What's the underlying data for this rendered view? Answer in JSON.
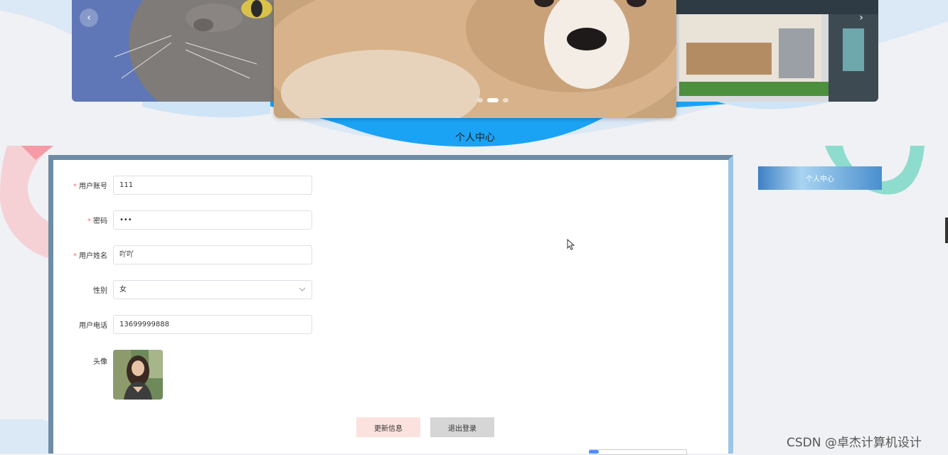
{
  "carousel": {
    "prev_icon": "chevron-left-icon",
    "next_icon": "chevron-right-icon",
    "prev_glyph": "‹",
    "next_glyph": "›",
    "slides": [
      "cat",
      "corgi",
      "pet-store"
    ],
    "active_index": 1
  },
  "page": {
    "title": "个人中心"
  },
  "form": {
    "username_label": "用户账号",
    "username_value": "111",
    "password_label": "密码",
    "password_value": "•••",
    "name_label": "用户姓名",
    "name_value": "吖吖",
    "gender_label": "性别",
    "gender_value": "女",
    "phone_label": "用户电话",
    "phone_value": "13699999888",
    "avatar_label": "头像",
    "required_mark": "*",
    "dropdown_icon": "chevron-down-icon"
  },
  "actions": {
    "update_label": "更新信息",
    "logout_label": "退出登录"
  },
  "sidebar": {
    "personal_center_label": "个人中心"
  },
  "watermark": {
    "text": "CSDN @卓杰计算机设计"
  },
  "colors": {
    "accent": "#1aa3f5",
    "panel_border": "#6e8ca6",
    "required": "#f56c6c"
  }
}
